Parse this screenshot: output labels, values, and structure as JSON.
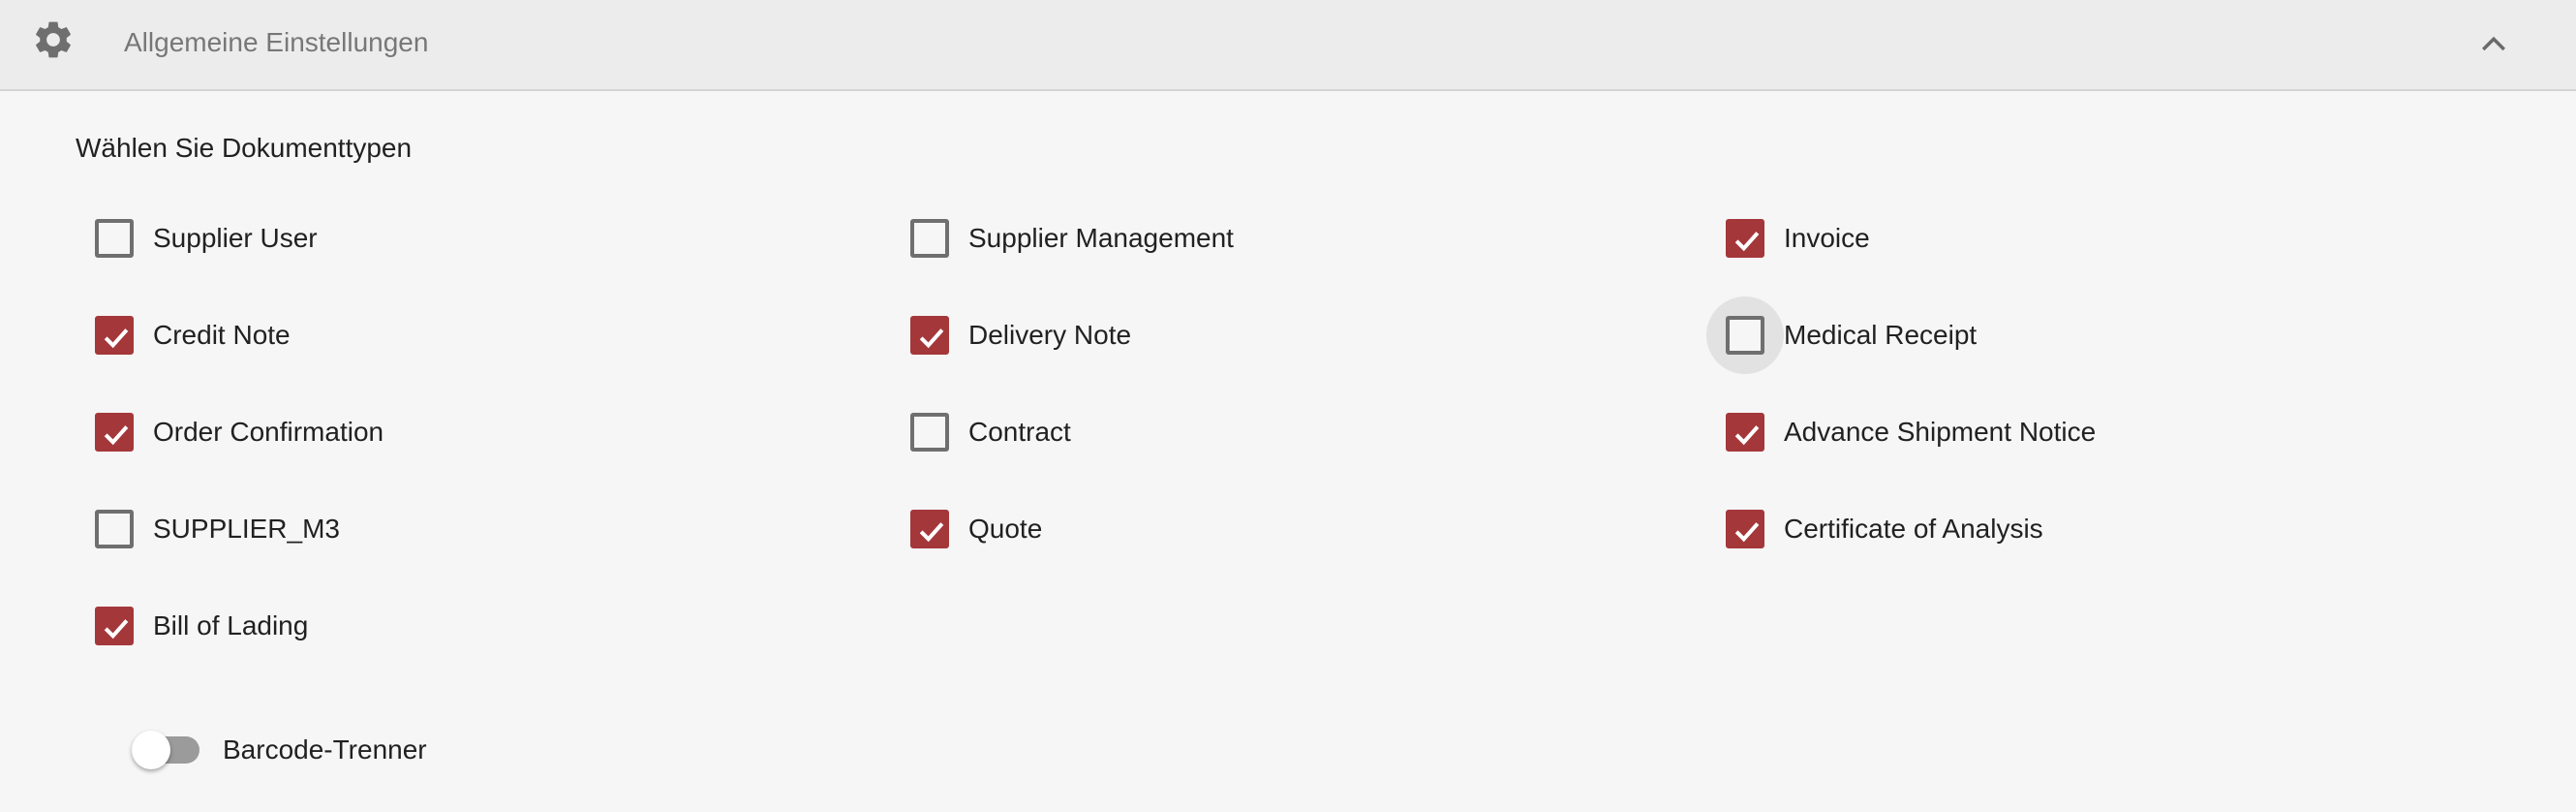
{
  "header": {
    "title": "Allgemeine Einstellungen",
    "icon": "gear-icon",
    "collapse_icon": "chevron-up-icon"
  },
  "section": {
    "label": "Wählen Sie Dokumenttypen"
  },
  "colors": {
    "accent": "#a4373a",
    "header_bg": "#ececec",
    "page_bg": "#f6f6f6"
  },
  "document_types": [
    {
      "label": "Supplier User",
      "checked": false
    },
    {
      "label": "Supplier Management",
      "checked": false
    },
    {
      "label": "Invoice",
      "checked": true
    },
    {
      "label": "Credit Note",
      "checked": true
    },
    {
      "label": "Delivery Note",
      "checked": true
    },
    {
      "label": "Medical Receipt",
      "checked": false
    },
    {
      "label": "Order Confirmation",
      "checked": true
    },
    {
      "label": "Contract",
      "checked": false
    },
    {
      "label": "Advance Shipment Notice",
      "checked": true
    },
    {
      "label": "SUPPLIER_M3",
      "checked": false
    },
    {
      "label": "Quote",
      "checked": true
    },
    {
      "label": "Certificate of Analysis",
      "checked": true
    },
    {
      "label": "Bill of Lading",
      "checked": true
    }
  ],
  "barcode_toggle": {
    "label": "Barcode-Trenner",
    "enabled": false
  }
}
